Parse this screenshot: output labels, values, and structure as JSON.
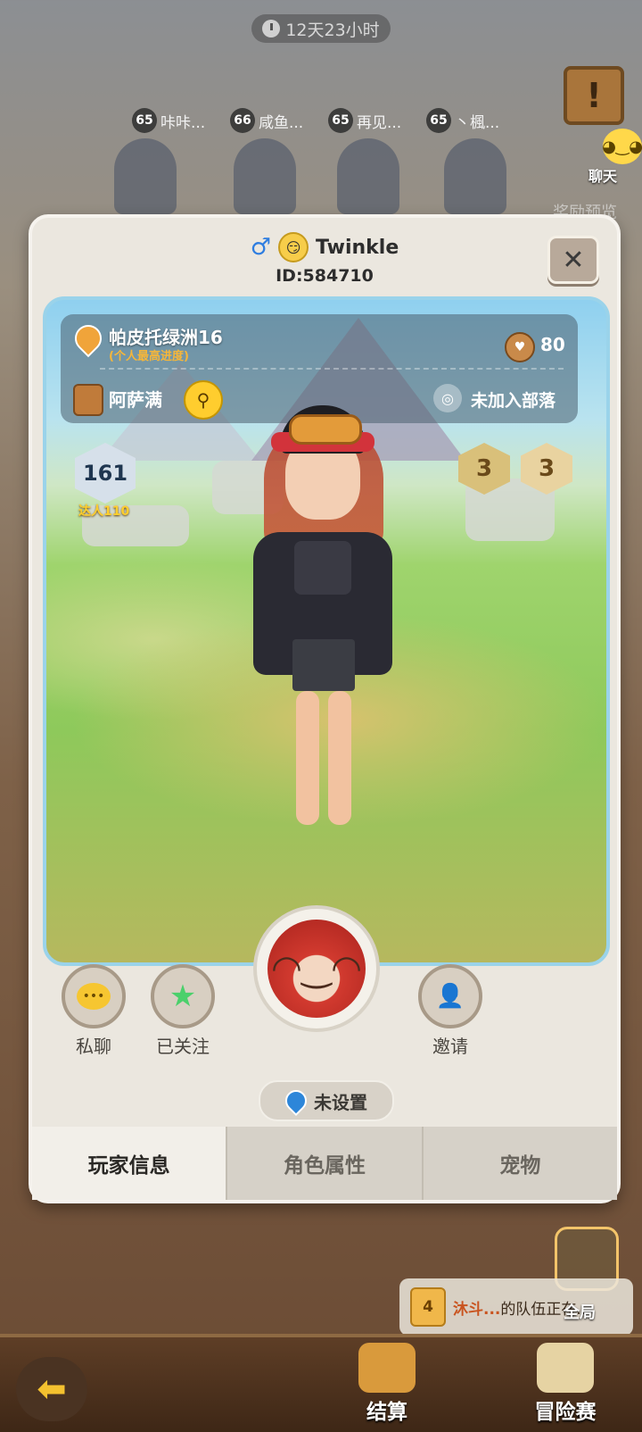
{
  "timer": {
    "icon": "clock-icon",
    "text": "12天23小时"
  },
  "top_players": [
    {
      "level": "65",
      "name": "咔咔..."
    },
    {
      "level": "66",
      "name": "咸鱼..."
    },
    {
      "level": "65",
      "name": "再见..."
    },
    {
      "level": "65",
      "name": "丶楓..."
    }
  ],
  "side": {
    "chat_label": "聊天",
    "reward_label": "奖励预览"
  },
  "profile": {
    "gender_icon": "male-icon",
    "name": "Twinkle",
    "id": "ID:584710",
    "close_label": "✕"
  },
  "info": {
    "location": "帕皮托绿洲16",
    "location_sub": "(个人最高进度)",
    "fans": "80",
    "job": "阿萨满",
    "tribe": "未加入部落"
  },
  "level": {
    "value": "161",
    "title": "达人110"
  },
  "badges": [
    {
      "label": "3",
      "color": "#d9c07a"
    },
    {
      "label": "3",
      "color": "#e9d3a0"
    }
  ],
  "actions": {
    "private_chat": "私聊",
    "followed": "已关注",
    "invite": "邀请"
  },
  "location_pill": "未设置",
  "tabs": [
    {
      "label": "玩家信息",
      "active": true
    },
    {
      "label": "角色属性",
      "active": false
    },
    {
      "label": "宠物",
      "active": false
    }
  ],
  "team_notice": {
    "num": "4",
    "name": "沐斗...",
    "text": "的队伍正在..."
  },
  "global_label": "全局",
  "bottom": {
    "settle": "结算",
    "adventure": "冒险赛"
  }
}
